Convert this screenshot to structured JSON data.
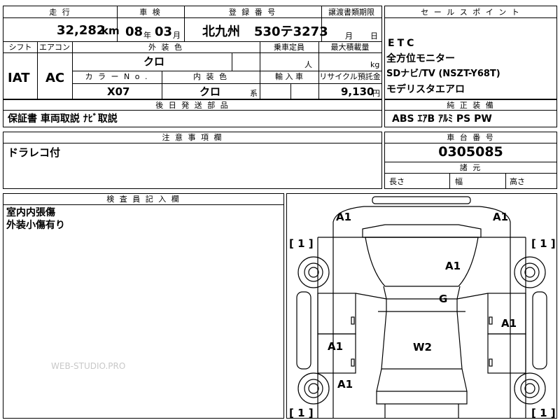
{
  "header": {
    "mileage_label": "走 行",
    "shaken_label": "車 検",
    "registration_label": "登 録 番 号",
    "transfer_deadline_label": "譲渡書類期限",
    "sales_points_label": "セ ー ル ス ポ イ ン ト"
  },
  "vehicle": {
    "mileage_value": "32,282",
    "mileage_unit": "km",
    "shaken_year": "08",
    "year_unit": "年",
    "shaken_month": "03",
    "month_unit": "月",
    "registration_region": "北九州",
    "registration_number": "530テ3273",
    "transfer_month_unit": "月",
    "transfer_day_unit": "日"
  },
  "row2": {
    "shift_label": "シフト",
    "aircon_label": "エアコン",
    "exterior_color_label": "外 装 色",
    "capacity_label": "乗車定員",
    "max_load_label": "最大積載量",
    "shift_value": "IAT",
    "aircon_value": "AC",
    "exterior_color_value": "クロ",
    "capacity_unit": "人",
    "load_unit": "kg",
    "color_no_label": "カ ラ ー N o .",
    "interior_color_label": "内 装 色",
    "import_label": "輸 入 車",
    "recycle_label": "リサイクル預託金",
    "color_no_value": "X07",
    "interior_color_value": "クロ",
    "interior_suffix": "系",
    "recycle_value": "9,130",
    "recycle_unit": "円"
  },
  "sales_points": [
    "ETC",
    "全方位モニター",
    "SDナビ/TV (NSZT-Y68T)",
    "モデリスタエアロ"
  ],
  "parts": {
    "label": "後 日 発 送 部 品",
    "value": "保証書 車両取説 ﾅﾋﾞ取説"
  },
  "equipment": {
    "label": "純 正 装 備",
    "value": "ABS ｴｱB ｱﾙﾐ PS PW"
  },
  "notes": {
    "label": "注 意 事 項 欄",
    "value": "ドラレコ付"
  },
  "chassis": {
    "label": "車 台 番 号",
    "value": "0305085"
  },
  "dimensions": {
    "label": "諸 元",
    "length_label": "長さ",
    "width_label": "幅",
    "height_label": "高さ"
  },
  "inspector": {
    "label": "検 査 員 記 入 欄",
    "line1": "室内内張傷",
    "line2": "外装小傷有り"
  },
  "watermark": "WEB-STUDIO.PRO",
  "damage_map": {
    "marks": [
      "A1",
      "A1",
      "A1",
      "G",
      "A1",
      "A1",
      "W2",
      "A1"
    ],
    "tire_marks": [
      "[ 1 ]",
      "[ 1 ]",
      "[ 1 ]",
      "[ 1 ]"
    ]
  }
}
